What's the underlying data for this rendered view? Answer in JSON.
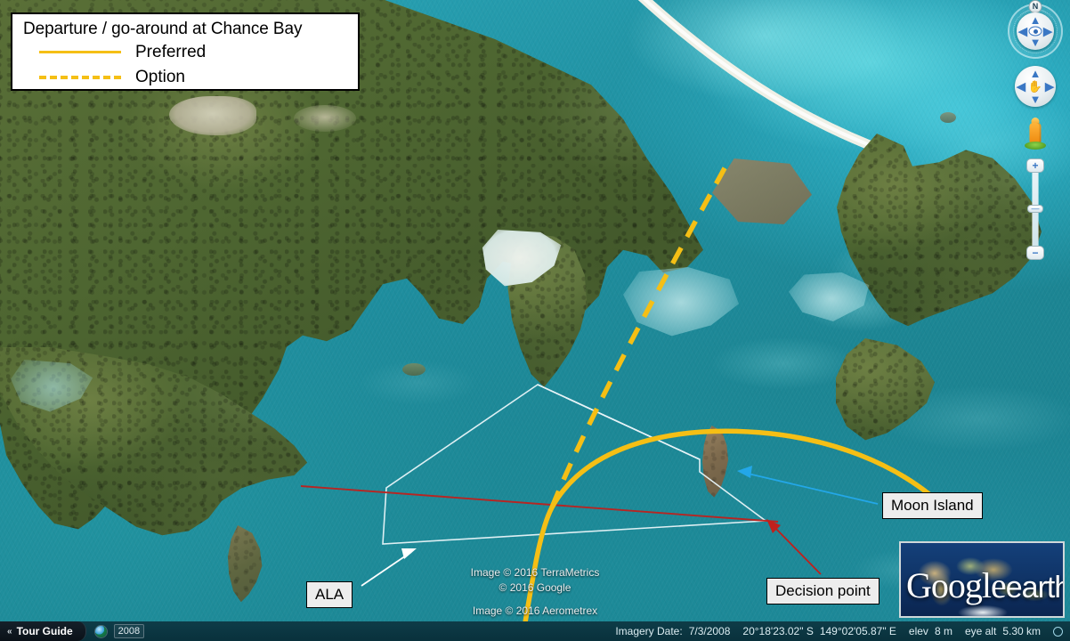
{
  "app": {
    "name": "Google Earth",
    "logo_google": "Google",
    "logo_earth": "earth"
  },
  "legend": {
    "title": "Departure / go-around at Chance Bay",
    "items": [
      {
        "style": "solid",
        "label": "Preferred",
        "color": "#f5bf15"
      },
      {
        "style": "dashed",
        "label": "Option",
        "color": "#f5bf15"
      }
    ]
  },
  "callouts": [
    {
      "id": "moon-island",
      "label": "Moon Island",
      "arrow_color": "#23a7e8"
    },
    {
      "id": "decision-point",
      "label": "Decision point",
      "arrow_color": "#c0201c"
    },
    {
      "id": "ala",
      "label": "ALA",
      "arrow_color": "#ffffff"
    }
  ],
  "nav": {
    "north_label": "N",
    "compass_name": "look-joystick",
    "pan_name": "pan-joystick",
    "pegman_name": "street-view-pegman",
    "zoom_in_label": "+",
    "zoom_out_label": "−",
    "zoom_thumb_label": "—"
  },
  "attribution": {
    "line1": "Image © 2016 TerraMetrics",
    "line2": "© 2016 Google",
    "line3": "Image © 2016 Aerometrex"
  },
  "statusbar": {
    "tour_guide": "Tour Guide",
    "tour_guide_chevron": "«",
    "year_badge": "2008",
    "imagery_date_label": "Imagery Date:",
    "imagery_date_value": "7/3/2008",
    "latitude": "20°18'23.02\" S",
    "longitude": "149°02'05.87\" E",
    "elev_label": "elev",
    "elev_value": "8 m",
    "eye_alt_label": "eye alt",
    "eye_alt_value": "5.30 km"
  },
  "overlay_colors": {
    "preferred_track": "#f5bf15",
    "option_track": "#f5bf15",
    "ala_polygon": "#e8f4f8",
    "red_line": "#c0201c",
    "cyan_arrow": "#23a7e8"
  }
}
